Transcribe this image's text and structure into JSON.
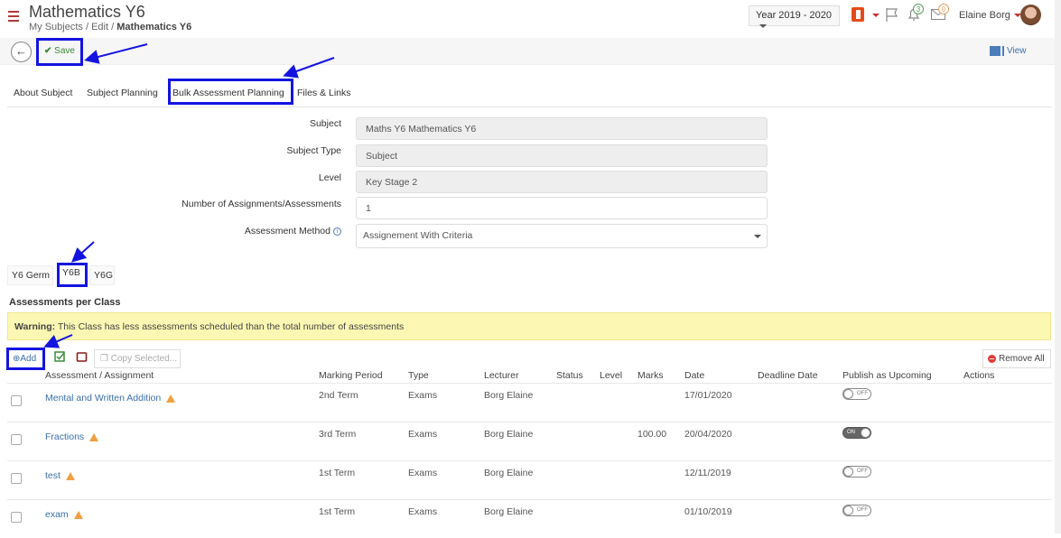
{
  "header": {
    "title": "Mathematics Y6",
    "breadcrumb": [
      "My Subjects",
      "Edit",
      "Mathematics Y6"
    ],
    "year": "Year 2019 - 2020",
    "notification_count": "3",
    "message_count": "0",
    "user_name": "Elaine Borg"
  },
  "toolbar": {
    "save_label": "Save",
    "view_label": "View"
  },
  "tabs": [
    {
      "label": "About Subject"
    },
    {
      "label": "Subject Planning"
    },
    {
      "label": "Bulk Assessment Planning"
    },
    {
      "label": "Files & Links"
    }
  ],
  "form": {
    "subject_label": "Subject",
    "subject_value": "Maths Y6 Mathematics  Y6",
    "type_label": "Subject Type",
    "type_value": "Subject",
    "level_label": "Level",
    "level_value": "Key Stage 2",
    "count_label": "Number of Assignments/Assessments",
    "count_value": "1",
    "method_label": "Assessment Method",
    "method_value": "Assignement With Criteria"
  },
  "class_tabs": [
    {
      "label": "Y6 Germ"
    },
    {
      "label": "Y6B"
    },
    {
      "label": "Y6G"
    }
  ],
  "section_title": "Assessments per Class",
  "warning": {
    "bold": "Warning:",
    "text": " This Class has less assessments scheduled than the total number of assessments"
  },
  "actions": {
    "add_label": "Add",
    "copy_label": "Copy Selected...",
    "remove_all_label": "Remove All"
  },
  "columns": [
    "Assessment / Assignment",
    "Marking Period",
    "Type",
    "Lecturer",
    "Status",
    "Level",
    "Marks",
    "Date",
    "Deadline Date",
    "Publish as Upcoming",
    "Actions"
  ],
  "rows": [
    {
      "name": "Mental and Written Addition",
      "period": "2nd Term",
      "type": "Exams",
      "lecturer": "Borg Elaine",
      "marks": "",
      "date": "17/01/2020",
      "publish": "OFF"
    },
    {
      "name": "Fractions",
      "period": "3rd Term",
      "type": "Exams",
      "lecturer": "Borg Elaine",
      "marks": "100.00",
      "date": "20/04/2020",
      "publish": "ON"
    },
    {
      "name": "test",
      "period": "1st Term",
      "type": "Exams",
      "lecturer": "Borg Elaine",
      "marks": "",
      "date": "12/11/2019",
      "publish": "OFF"
    },
    {
      "name": "exam",
      "period": "1st Term",
      "type": "Exams",
      "lecturer": "Borg Elaine",
      "marks": "",
      "date": "01/10/2019",
      "publish": "OFF"
    }
  ],
  "colors": {
    "accent": "#1414e0",
    "link": "#3a6fa8",
    "warning_bg": "#fcf8b3"
  }
}
